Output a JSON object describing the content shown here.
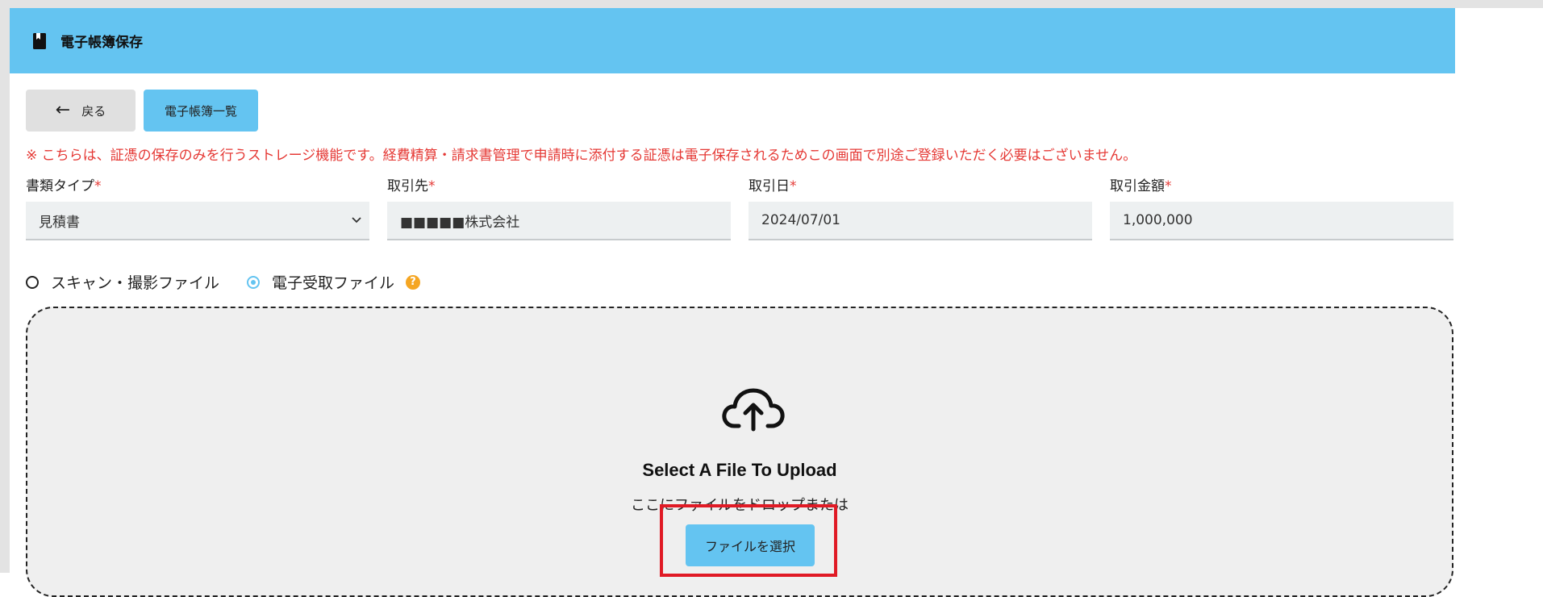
{
  "header": {
    "title": "電子帳簿保存",
    "icon": "book-icon"
  },
  "toolbar": {
    "back_label": "戻る",
    "list_label": "電子帳簿一覧"
  },
  "notice": "※ こちらは、証憑の保存のみを行うストレージ機能です。経費精算・請求書管理で申請時に添付する証憑は電子保存されるためこの画面で別途ご登録いただく必要はございません。",
  "fields": {
    "doc_type": {
      "label": "書類タイプ",
      "required": "*",
      "value": "見積書"
    },
    "partner": {
      "label": "取引先",
      "required": "*",
      "value": "■■■■■株式会社"
    },
    "date": {
      "label": "取引日",
      "required": "*",
      "value": "2024/07/01"
    },
    "amount": {
      "label": "取引金額",
      "required": "*",
      "value": "1,000,000"
    }
  },
  "file_source": {
    "options": [
      "スキャン・撮影ファイル",
      "電子受取ファイル"
    ],
    "selected": "電子受取ファイル",
    "help": "?"
  },
  "dropzone": {
    "title": "Select A File To Upload",
    "subtitle": "ここにファイルをドロップまたは",
    "button_label": "ファイルを選択"
  },
  "colors": {
    "accent": "#64c4f1",
    "warning": "#e53935",
    "highlight": "#e01a25",
    "help": "#f5a623"
  }
}
